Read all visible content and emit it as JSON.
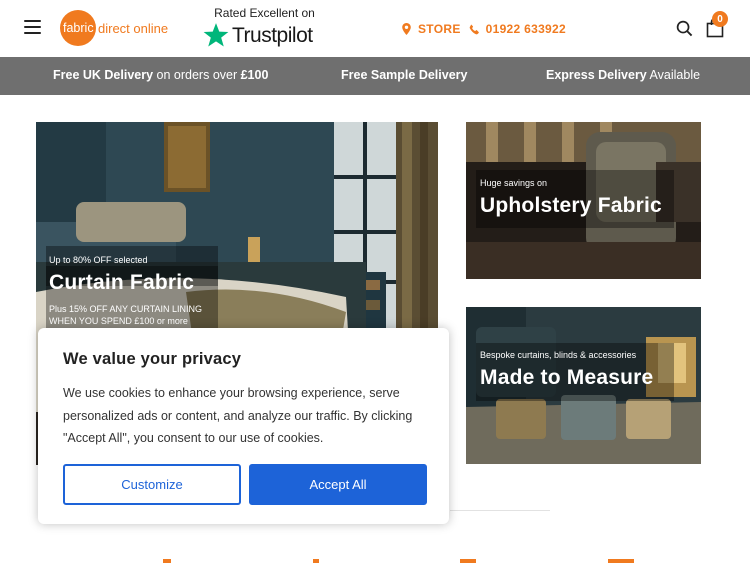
{
  "header": {
    "logo_circle_text": "fabric",
    "logo_text": "direct online",
    "rated_label": "Rated Excellent on",
    "trustpilot_word": "Trustpilot",
    "store_label": "STORE",
    "phone": "01922 633922",
    "cart_count": "0",
    "accent_color": "#f07a1f"
  },
  "promo": {
    "item1_bold": "Free UK Delivery",
    "item1_rest": " on orders over ",
    "item1_amount": "£100",
    "item2_bold": "Free Sample Delivery",
    "item3_bold": "Express Delivery",
    "item3_rest": " Available"
  },
  "tiles": {
    "curtain": {
      "small": "Up to 80% OFF selected",
      "title": "Curtain Fabric",
      "note_line1": "Plus 15% OFF ANY CURTAIN LINING",
      "note_line2": "WHEN YOU SPEND £100 or more"
    },
    "upholstery": {
      "small": "Huge savings on",
      "title": "Upholstery Fabric"
    },
    "mtm": {
      "small": "Bespoke curtains, blinds & accessories",
      "title": "Made to Measure"
    }
  },
  "cookie": {
    "title": "We value your privacy",
    "body": "We use cookies to enhance your browsing experience, serve personalized ads or content, and analyze our traffic. By clicking \"Accept All\", you consent to our use of cookies.",
    "customize_label": "Customize",
    "accept_label": "Accept All",
    "button_color": "#1d63d8"
  }
}
